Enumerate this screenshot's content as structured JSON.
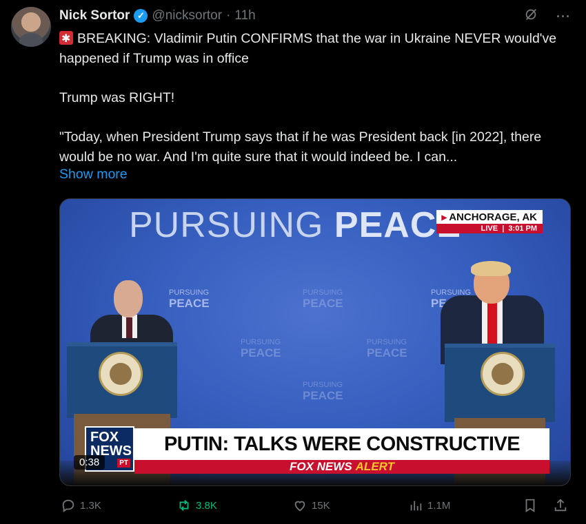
{
  "author": {
    "name": "Nick Sortor",
    "handle": "@nicksortor",
    "separator": "·",
    "time": "11h"
  },
  "tweet": {
    "line1": "BREAKING: Vladimir Putin CONFIRMS that the war in Ukraine NEVER would've happened if Trump was in office",
    "line2": "Trump was RIGHT!",
    "line3": "\"Today, when President Trump says that if he was President back [in 2022], there would be no war. And I'm quite sure that it would indeed be. I can...",
    "show_more": "Show more"
  },
  "media": {
    "backdrop_title_light": "PURSUING ",
    "backdrop_title_bold": "PEACE",
    "logo_top": "PURSUING",
    "logo_bottom": "PEACE",
    "location": "ANCHORAGE, AK",
    "live_label": "LIVE",
    "live_time": "3:01 PM",
    "chyron": "PUTIN: TALKS WERE CONSTRUCTIVE",
    "alert_brand": "FOX NEWS",
    "alert_word": "ALERT",
    "network_logo_line1": "FOX",
    "network_logo_line2": "NEWS",
    "network_logo_tz": "PT",
    "duration": "0:38"
  },
  "actions": {
    "replies": "1.3K",
    "reposts": "3.8K",
    "likes": "15K",
    "views": "1.1M"
  },
  "colors": {
    "accent": "#1d9bf0",
    "repost": "#00ba7c",
    "muted": "#71767b",
    "fox_red": "#c8102e"
  }
}
